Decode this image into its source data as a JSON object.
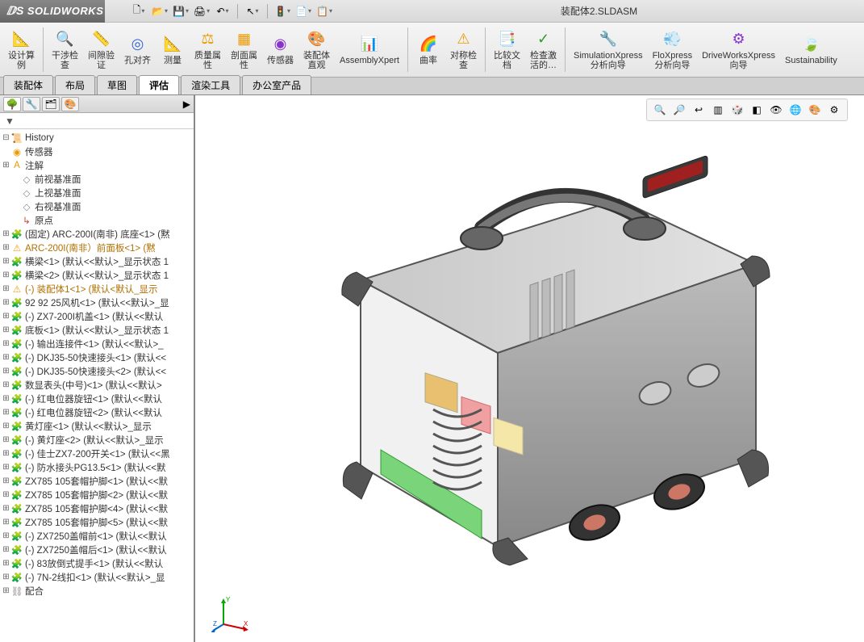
{
  "app": {
    "name": "SOLIDWORKS",
    "document": "装配体2.SLDASM"
  },
  "qat": [
    {
      "name": "new",
      "glyph": "🗋"
    },
    {
      "name": "open",
      "glyph": "📂"
    },
    {
      "name": "save",
      "glyph": "💾"
    },
    {
      "name": "print",
      "glyph": "🖨"
    },
    {
      "name": "undo",
      "glyph": "↶"
    },
    {
      "name": "select",
      "glyph": "↖"
    },
    {
      "name": "rebuild",
      "glyph": "🚦"
    },
    {
      "name": "options",
      "glyph": "📄"
    },
    {
      "name": "properties",
      "glyph": "📋"
    }
  ],
  "ribbon": [
    {
      "name": "design-study",
      "label": "设计算\n例",
      "glyph": "📐",
      "color": "c-blue"
    },
    {
      "sep": true
    },
    {
      "name": "interference",
      "label": "干涉检\n查",
      "glyph": "🔍",
      "color": "c-orange"
    },
    {
      "name": "clearance",
      "label": "间隙验\n证",
      "glyph": "📏",
      "color": "c-orange"
    },
    {
      "name": "hole-align",
      "label": "孔对齐",
      "glyph": "◎",
      "color": "c-blue"
    },
    {
      "name": "measure",
      "label": "测量",
      "glyph": "📐",
      "color": "c-teal"
    },
    {
      "name": "mass-props",
      "label": "质量属\n性",
      "glyph": "⚖",
      "color": "c-orange"
    },
    {
      "name": "section-props",
      "label": "剖面属\n性",
      "glyph": "▦",
      "color": "c-orange"
    },
    {
      "name": "sensor",
      "label": "传感器",
      "glyph": "◉",
      "color": "c-purple"
    },
    {
      "name": "assembly-visual",
      "label": "装配体\n直观",
      "glyph": "🎨",
      "color": "c-teal"
    },
    {
      "name": "assemblyxpert",
      "label": "AssemblyXpert",
      "glyph": "📊",
      "color": "c-gray"
    },
    {
      "sep": true
    },
    {
      "name": "curvature",
      "label": "曲率",
      "glyph": "🌈",
      "color": "c-purple"
    },
    {
      "name": "symmetry",
      "label": "对称检\n查",
      "glyph": "⚠",
      "color": "c-orange"
    },
    {
      "sep": true
    },
    {
      "name": "compare",
      "label": "比较文\n档",
      "glyph": "📑",
      "color": "c-blue"
    },
    {
      "name": "check-active",
      "label": "检查激\n活的…",
      "glyph": "✓",
      "color": "c-green"
    },
    {
      "sep": true
    },
    {
      "name": "simulationxpress",
      "label": "SimulationXpress\n分析向导",
      "glyph": "🔧",
      "color": "c-red"
    },
    {
      "name": "floxpress",
      "label": "FloXpress\n分析向导",
      "glyph": "💨",
      "color": "c-blue"
    },
    {
      "name": "driveworksxpress",
      "label": "DriveWorksXpress\n向导",
      "glyph": "⚙",
      "color": "c-purple"
    },
    {
      "name": "sustainability",
      "label": "Sustainability",
      "glyph": "🍃",
      "color": "c-green"
    }
  ],
  "tabs": [
    {
      "name": "assembly",
      "label": "装配体"
    },
    {
      "name": "layout",
      "label": "布局"
    },
    {
      "name": "sketch",
      "label": "草图"
    },
    {
      "name": "evaluate",
      "label": "评估",
      "active": true
    },
    {
      "name": "render",
      "label": "渲染工具"
    },
    {
      "name": "office",
      "label": "办公室产品"
    }
  ],
  "viewToolbar": [
    {
      "name": "zoom-fit",
      "glyph": "🔍"
    },
    {
      "name": "zoom-area",
      "glyph": "🔎"
    },
    {
      "name": "prev-view",
      "glyph": "↩"
    },
    {
      "name": "section",
      "glyph": "▥"
    },
    {
      "name": "view-orient",
      "glyph": "🎲"
    },
    {
      "name": "display-style",
      "glyph": "◧"
    },
    {
      "name": "hide-show",
      "glyph": "👁"
    },
    {
      "name": "scene",
      "glyph": "🌐"
    },
    {
      "name": "appearance",
      "glyph": "🎨"
    },
    {
      "name": "view-settings",
      "glyph": "⚙"
    }
  ],
  "filterLabel": "▼",
  "tree": [
    {
      "tw": "⊟",
      "icon": "📜",
      "color": "c-orange",
      "label": "History",
      "indent": 0
    },
    {
      "tw": "",
      "icon": "◉",
      "color": "c-orange",
      "label": "传感器",
      "indent": 0
    },
    {
      "tw": "⊞",
      "icon": "A",
      "color": "c-orange",
      "label": "注解",
      "indent": 0
    },
    {
      "tw": "",
      "icon": "◇",
      "color": "c-gray",
      "label": "前视基准面",
      "indent": 1
    },
    {
      "tw": "",
      "icon": "◇",
      "color": "c-gray",
      "label": "上视基准面",
      "indent": 1
    },
    {
      "tw": "",
      "icon": "◇",
      "color": "c-gray",
      "label": "右视基准面",
      "indent": 1
    },
    {
      "tw": "",
      "icon": "↳",
      "color": "c-red",
      "label": "原点",
      "indent": 1
    },
    {
      "tw": "⊞",
      "icon": "🧩",
      "color": "c-orange",
      "label": "(固定) ARC-200I(南非) 底座<1> (黙",
      "indent": 0
    },
    {
      "tw": "⊞",
      "icon": "⚠",
      "color": "c-orange",
      "label": "ARC-200I(南非）前面板<1> (黙",
      "indent": 0,
      "hl": true
    },
    {
      "tw": "⊞",
      "icon": "🧩",
      "color": "c-orange",
      "label": "横梁<1> (默认<<默认>_显示状态 1",
      "indent": 0
    },
    {
      "tw": "⊞",
      "icon": "🧩",
      "color": "c-orange",
      "label": "横梁<2> (默认<<默认>_显示状态 1",
      "indent": 0
    },
    {
      "tw": "⊞",
      "icon": "⚠",
      "color": "c-orange",
      "label": "(-) 装配体1<1> (默认<默认_显示",
      "indent": 0,
      "hl": true
    },
    {
      "tw": "⊞",
      "icon": "🧩",
      "color": "c-orange",
      "label": "92 92 25风机<1> (默认<<默认>_显",
      "indent": 0
    },
    {
      "tw": "⊞",
      "icon": "🧩",
      "color": "c-orange",
      "label": "(-) ZX7-200I机盖<1> (默认<<默认",
      "indent": 0
    },
    {
      "tw": "⊞",
      "icon": "🧩",
      "color": "c-orange",
      "label": "底板<1> (默认<<默认>_显示状态 1",
      "indent": 0
    },
    {
      "tw": "⊞",
      "icon": "🧩",
      "color": "c-orange",
      "label": "(-) 输出连接件<1> (默认<<默认>_",
      "indent": 0
    },
    {
      "tw": "⊞",
      "icon": "🧩",
      "color": "c-orange",
      "label": "(-) DKJ35-50快速接头<1> (默认<<",
      "indent": 0
    },
    {
      "tw": "⊞",
      "icon": "🧩",
      "color": "c-orange",
      "label": "(-) DKJ35-50快速接头<2> (默认<<",
      "indent": 0
    },
    {
      "tw": "⊞",
      "icon": "🧩",
      "color": "c-orange",
      "label": "数显表头(中号)<1> (默认<<默认>",
      "indent": 0
    },
    {
      "tw": "⊞",
      "icon": "🧩",
      "color": "c-orange",
      "label": "(-) 红电位器旋钮<1> (默认<<默认",
      "indent": 0
    },
    {
      "tw": "⊞",
      "icon": "🧩",
      "color": "c-orange",
      "label": "(-) 红电位器旋钮<2> (默认<<默认",
      "indent": 0
    },
    {
      "tw": "⊞",
      "icon": "🧩",
      "color": "c-orange",
      "label": "黄灯座<1> (默认<<默认>_显示",
      "indent": 0
    },
    {
      "tw": "⊞",
      "icon": "🧩",
      "color": "c-orange",
      "label": "(-) 黄灯座<2> (默认<<默认>_显示",
      "indent": 0
    },
    {
      "tw": "⊞",
      "icon": "🧩",
      "color": "c-orange",
      "label": "(-) 佳士ZX7-200开关<1> (默认<<黑",
      "indent": 0
    },
    {
      "tw": "⊞",
      "icon": "🧩",
      "color": "c-orange",
      "label": "(-) 防水接头PG13.5<1> (默认<<默",
      "indent": 0
    },
    {
      "tw": "⊞",
      "icon": "🧩",
      "color": "c-orange",
      "label": "ZX785 105套帽护脚<1> (默认<<默",
      "indent": 0
    },
    {
      "tw": "⊞",
      "icon": "🧩",
      "color": "c-orange",
      "label": "ZX785 105套帽护脚<2> (默认<<默",
      "indent": 0
    },
    {
      "tw": "⊞",
      "icon": "🧩",
      "color": "c-orange",
      "label": "ZX785 105套帽护脚<4> (默认<<默",
      "indent": 0
    },
    {
      "tw": "⊞",
      "icon": "🧩",
      "color": "c-orange",
      "label": "ZX785 105套帽护脚<5> (默认<<默",
      "indent": 0
    },
    {
      "tw": "⊞",
      "icon": "🧩",
      "color": "c-orange",
      "label": "(-) ZX7250盖帽前<1> (默认<<默认",
      "indent": 0
    },
    {
      "tw": "⊞",
      "icon": "🧩",
      "color": "c-orange",
      "label": "(-) ZX7250盖帽后<1> (默认<<默认",
      "indent": 0
    },
    {
      "tw": "⊞",
      "icon": "🧩",
      "color": "c-orange",
      "label": "(-) 83放倒式提手<1> (默认<<默认",
      "indent": 0
    },
    {
      "tw": "⊞",
      "icon": "🧩",
      "color": "c-orange",
      "label": "(-) 7N-2线扣<1> (默认<<默认>_显",
      "indent": 0
    },
    {
      "tw": "⊞",
      "icon": "⛓",
      "color": "c-gray",
      "label": "配合",
      "indent": 0
    }
  ]
}
